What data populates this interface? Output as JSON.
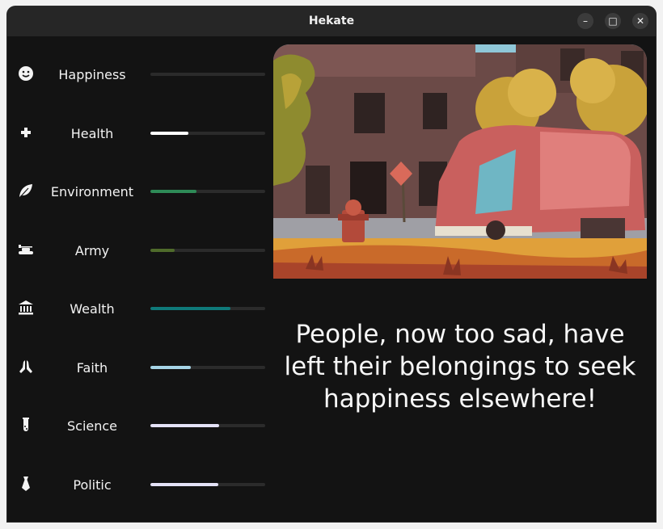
{
  "window": {
    "title": "Hekate",
    "controls": {
      "minimize": "–",
      "maximize": "□",
      "close": "✕"
    }
  },
  "stats": [
    {
      "label": "Happiness",
      "icon": "smiley-icon",
      "value": 0.0,
      "color": "#c8c8c8"
    },
    {
      "label": "Health",
      "icon": "plus-icon",
      "value": 0.33,
      "color": "#ffffff"
    },
    {
      "label": "Environment",
      "icon": "leaf-icon",
      "value": 0.4,
      "color": "#2e8b57"
    },
    {
      "label": "Army",
      "icon": "tank-icon",
      "value": 0.21,
      "color": "#4f6b2b"
    },
    {
      "label": "Wealth",
      "icon": "bank-icon",
      "value": 0.7,
      "color": "#0f7a7a"
    },
    {
      "label": "Faith",
      "icon": "praying-hands-icon",
      "value": 0.35,
      "color": "#a6d4e6"
    },
    {
      "label": "Science",
      "icon": "test-tube-icon",
      "value": 0.6,
      "color": "#e4e2f7"
    },
    {
      "label": "Politic",
      "icon": "tie-icon",
      "value": 0.59,
      "color": "#e4e2f7"
    }
  ],
  "message": "People, now too sad, have left their belongings to seek happiness elsewhere!",
  "scene": {
    "description_icon": "abandoned-city-illustration"
  }
}
